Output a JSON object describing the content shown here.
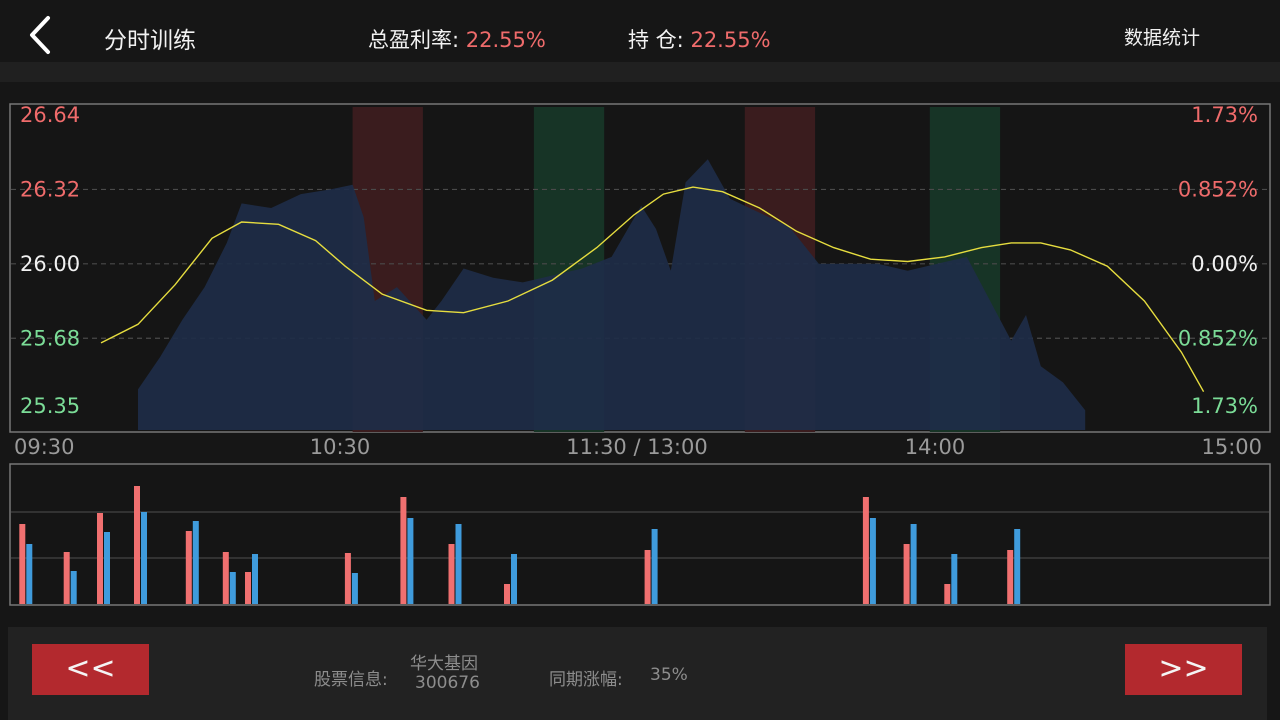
{
  "header": {
    "title": "分时训练",
    "total_label": "总盈利率:",
    "total_value": "22.55%",
    "position_label": "持 仓:",
    "position_value": "22.55%",
    "stats_button": "数据统计",
    "back_icon": "chevron-left-icon"
  },
  "colors": {
    "up": "#ef6b6b",
    "down": "#7bdc97",
    "area_fill": "#1e2d48",
    "buy_band": "#3a1c1e",
    "sell_band": "#173426",
    "average_line": "#e6dd3f",
    "vol_red": "#f07070",
    "vol_blue": "#3f9bdc",
    "button": "#b3292e"
  },
  "chart_data": [
    {
      "type": "area",
      "title": "",
      "x_ticks": [
        "09:30",
        "10:30",
        "11:30 / 13:00",
        "14:00",
        "15:00"
      ],
      "y_ticks_left": [
        {
          "value": 26.64,
          "label": "26.64",
          "trend": "up"
        },
        {
          "value": 26.32,
          "label": "26.32",
          "trend": "up"
        },
        {
          "value": 26.0,
          "label": "26.00",
          "trend": "flat"
        },
        {
          "value": 25.68,
          "label": "25.68",
          "trend": "down"
        },
        {
          "value": 25.35,
          "label": "25.35",
          "trend": "down"
        }
      ],
      "y_ticks_right": [
        {
          "label": "1.73%",
          "trend": "up"
        },
        {
          "label": "0.852%",
          "trend": "up"
        },
        {
          "label": "0.00%",
          "trend": "flat"
        },
        {
          "label": "0.852%",
          "trend": "down"
        },
        {
          "label": "1.73%",
          "trend": "down"
        }
      ],
      "ylim": [
        25.35,
        26.64
      ],
      "xlim": [
        0,
        240
      ],
      "grid": true,
      "series": [
        {
          "kind": "price",
          "points": [
            [
              0,
              25.46
            ],
            [
              6,
              25.6
            ],
            [
              12,
              25.76
            ],
            [
              18,
              25.9
            ],
            [
              24,
              26.09
            ],
            [
              28,
              26.26
            ],
            [
              36,
              26.24
            ],
            [
              44,
              26.3
            ],
            [
              52,
              26.32
            ],
            [
              58,
              26.34
            ],
            [
              61,
              26.2
            ],
            [
              64,
              25.84
            ],
            [
              70,
              25.9
            ],
            [
              78,
              25.76
            ],
            [
              82,
              25.84
            ],
            [
              88,
              25.98
            ],
            [
              96,
              25.94
            ],
            [
              104,
              25.92
            ],
            [
              112,
              25.95
            ],
            [
              120,
              25.98
            ],
            [
              128,
              26.03
            ],
            [
              136,
              26.25
            ],
            [
              140,
              26.15
            ],
            [
              144,
              25.97
            ],
            [
              148,
              26.35
            ],
            [
              154,
              26.45
            ],
            [
              160,
              26.28
            ],
            [
              168,
              26.22
            ],
            [
              176,
              26.16
            ],
            [
              184,
              26.0
            ],
            [
              192,
              26.0
            ],
            [
              200,
              26.0
            ],
            [
              208,
              25.97
            ],
            [
              216,
              26.0
            ],
            [
              224,
              26.03
            ],
            [
              226,
              25.97
            ],
            [
              230,
              25.85
            ],
            [
              236,
              25.67
            ],
            [
              240,
              25.78
            ],
            [
              244,
              25.56
            ],
            [
              250,
              25.49
            ],
            [
              256,
              25.37
            ]
          ]
        },
        {
          "kind": "average",
          "points": [
            [
              -10,
              25.66
            ],
            [
              0,
              25.74
            ],
            [
              10,
              25.91
            ],
            [
              20,
              26.11
            ],
            [
              28,
              26.18
            ],
            [
              38,
              26.17
            ],
            [
              48,
              26.1
            ],
            [
              56,
              25.99
            ],
            [
              66,
              25.87
            ],
            [
              78,
              25.8
            ],
            [
              88,
              25.79
            ],
            [
              100,
              25.84
            ],
            [
              112,
              25.93
            ],
            [
              124,
              26.07
            ],
            [
              134,
              26.21
            ],
            [
              142,
              26.3
            ],
            [
              150,
              26.33
            ],
            [
              158,
              26.31
            ],
            [
              168,
              26.24
            ],
            [
              178,
              26.14
            ],
            [
              188,
              26.07
            ],
            [
              198,
              26.02
            ],
            [
              208,
              26.01
            ],
            [
              218,
              26.03
            ],
            [
              228,
              26.07
            ],
            [
              236,
              26.09
            ],
            [
              244,
              26.09
            ],
            [
              252,
              26.06
            ],
            [
              262,
              25.99
            ],
            [
              272,
              25.84
            ],
            [
              282,
              25.62
            ],
            [
              288,
              25.45
            ]
          ]
        }
      ],
      "bands": [
        {
          "type": "buy",
          "from": 58,
          "to": 77
        },
        {
          "type": "sell",
          "from": 107,
          "to": 126
        },
        {
          "type": "buy",
          "from": 164,
          "to": 183
        },
        {
          "type": "sell",
          "from": 214,
          "to": 233
        }
      ]
    },
    {
      "type": "bar",
      "title": "",
      "ylim": [
        0,
        120
      ],
      "series": [
        {
          "color": "red",
          "points": [
            [
              -31,
              80
            ],
            [
              -19,
              52
            ],
            [
              -10,
              91
            ],
            [
              0,
              118
            ],
            [
              14,
              73
            ],
            [
              24,
              52
            ],
            [
              30,
              32
            ],
            [
              57,
              51
            ],
            [
              72,
              107
            ],
            [
              85,
              60
            ],
            [
              100,
              20
            ],
            [
              138,
              54
            ],
            [
              197,
              107
            ],
            [
              208,
              60
            ],
            [
              219,
              20
            ],
            [
              236,
              54
            ]
          ]
        },
        {
          "color": "blue",
          "points": [
            [
              -31,
              60
            ],
            [
              -19,
              33
            ],
            [
              -10,
              72
            ],
            [
              0,
              92
            ],
            [
              14,
              83
            ],
            [
              24,
              32
            ],
            [
              30,
              50
            ],
            [
              57,
              31
            ],
            [
              72,
              86
            ],
            [
              85,
              80
            ],
            [
              100,
              50
            ],
            [
              138,
              75
            ],
            [
              197,
              86
            ],
            [
              208,
              80
            ],
            [
              219,
              50
            ],
            [
              236,
              75
            ]
          ]
        }
      ]
    }
  ],
  "footer": {
    "prev_button": "<<",
    "next_button": ">>",
    "stock_label": "股票信息:",
    "stock_name": "华大基因",
    "stock_code": "300676",
    "change_label": "同期涨幅:",
    "change_value": "35%"
  }
}
